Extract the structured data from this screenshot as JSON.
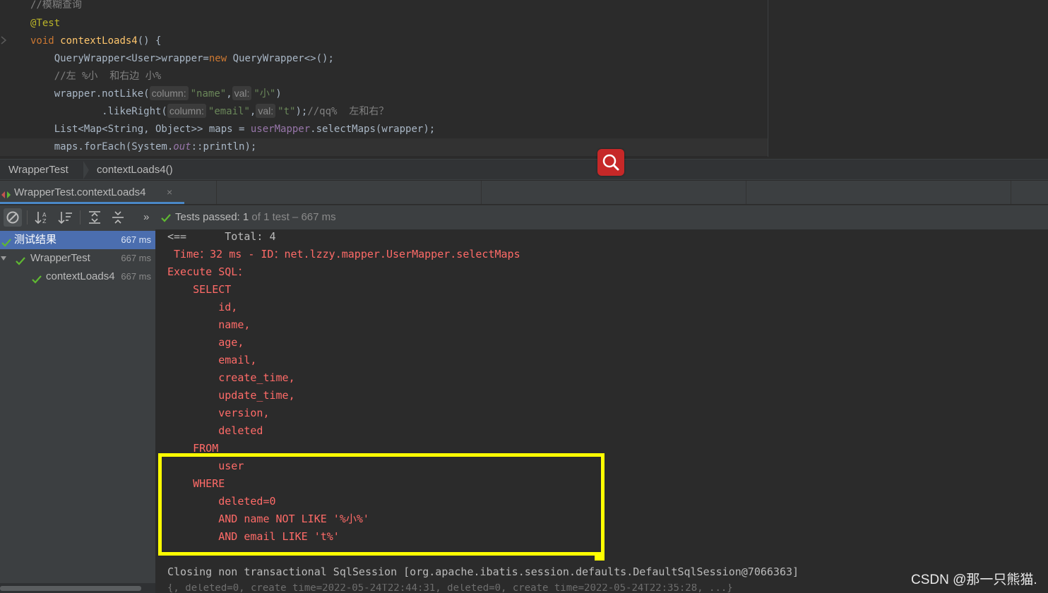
{
  "editor": {
    "lines": [
      {
        "segments": [
          {
            "t": "//模糊查询",
            "c": "c-comment"
          }
        ]
      },
      {
        "segments": [
          {
            "t": "@Test",
            "c": "c-anno"
          }
        ]
      },
      {
        "segments": [
          {
            "t": "void ",
            "c": "c-kw"
          },
          {
            "t": "contextLoads4",
            "c": "c-fn"
          },
          {
            "t": "() {",
            "c": ""
          }
        ]
      },
      {
        "segments": [
          {
            "t": "    QueryWrapper<User>wrapper=",
            "c": ""
          },
          {
            "t": "new ",
            "c": "c-kw"
          },
          {
            "t": "QueryWrapper<>();",
            "c": ""
          }
        ]
      },
      {
        "segments": [
          {
            "t": "    //左 %小  和右边 小%",
            "c": "c-comment"
          }
        ]
      },
      {
        "segments": [
          {
            "t": "    wrapper.notLike(",
            "c": ""
          },
          {
            "hint": "column:"
          },
          {
            "t": "\"name\"",
            "c": "c-str"
          },
          {
            "t": ",",
            "c": ""
          },
          {
            "hint": "val:"
          },
          {
            "t": "\"小\"",
            "c": "c-str"
          },
          {
            "t": ")",
            "c": ""
          }
        ]
      },
      {
        "segments": [
          {
            "t": "            .likeRight(",
            "c": ""
          },
          {
            "hint": "column:"
          },
          {
            "t": "\"email\"",
            "c": "c-str"
          },
          {
            "t": ",",
            "c": ""
          },
          {
            "hint": "val:"
          },
          {
            "t": "\"t\"",
            "c": "c-str"
          },
          {
            "t": ");",
            "c": ""
          },
          {
            "t": "//qq%  左和右？",
            "c": "c-comment"
          }
        ]
      },
      {
        "segments": [
          {
            "t": "    List<Map<String, Object>> maps = ",
            "c": ""
          },
          {
            "t": "userMapper",
            "c": "c-field"
          },
          {
            "t": ".selectMaps(wrapper);",
            "c": ""
          }
        ]
      },
      {
        "segments": [
          {
            "t": "    maps.forEach(System.",
            "c": ""
          },
          {
            "t": "out",
            "c": "c-static"
          },
          {
            "t": "::println);",
            "c": ""
          }
        ]
      }
    ]
  },
  "breadcrumb": {
    "items": [
      "WrapperTest",
      "contextLoads4()"
    ]
  },
  "run_tab": {
    "label": "WrapperTest.contextLoads4",
    "close": "×"
  },
  "toolbar": {
    "status_prefix": "Tests passed: ",
    "passed": "1",
    "status_suffix": " of 1 test – 667 ms",
    "more": "»"
  },
  "tree": {
    "rows": [
      {
        "label": "测试结果",
        "time": "667 ms"
      },
      {
        "label": "WrapperTest",
        "time": "667 ms"
      },
      {
        "label": "contextLoads4",
        "time": "667 ms"
      }
    ]
  },
  "console": {
    "lines": [
      {
        "text": "<==      Total: 4",
        "kind": "normal"
      },
      {
        "text": " Time：32 ms - ID：net.lzzy.mapper.UserMapper.selectMaps",
        "kind": "err"
      },
      {
        "text": "Execute SQL：",
        "kind": "err"
      },
      {
        "text": "    SELECT",
        "kind": "err"
      },
      {
        "text": "        id,",
        "kind": "err"
      },
      {
        "text": "        name,",
        "kind": "err"
      },
      {
        "text": "        age,",
        "kind": "err"
      },
      {
        "text": "        email,",
        "kind": "err"
      },
      {
        "text": "        create_time,",
        "kind": "err"
      },
      {
        "text": "        update_time,",
        "kind": "err"
      },
      {
        "text": "        version,",
        "kind": "err"
      },
      {
        "text": "        deleted",
        "kind": "err"
      },
      {
        "text": "    FROM",
        "kind": "err"
      },
      {
        "text": "        user",
        "kind": "err"
      },
      {
        "text": "    WHERE",
        "kind": "err"
      },
      {
        "text": "        deleted=0",
        "kind": "err"
      },
      {
        "text": "        AND name NOT LIKE '%小%'",
        "kind": "err"
      },
      {
        "text": "        AND email LIKE 't%'",
        "kind": "err"
      },
      {
        "text": "",
        "kind": "normal"
      },
      {
        "text": "Closing non transactional SqlSession [org.apache.ibatis.session.defaults.DefaultSqlSession@7066363]",
        "kind": "normal"
      }
    ],
    "partial_line": "{, deleted=0, create_time=2022-05-24T22:44:31, deleted=0, create_time=2022-05-24T22:35:28, ...}"
  },
  "watermark": "CSDN @那一只熊猫.",
  "colors": {
    "highlight": "#ffff00",
    "selection": "#4b6eaf",
    "error_text": "#ff6b68",
    "pass_green": "#5fb832"
  }
}
